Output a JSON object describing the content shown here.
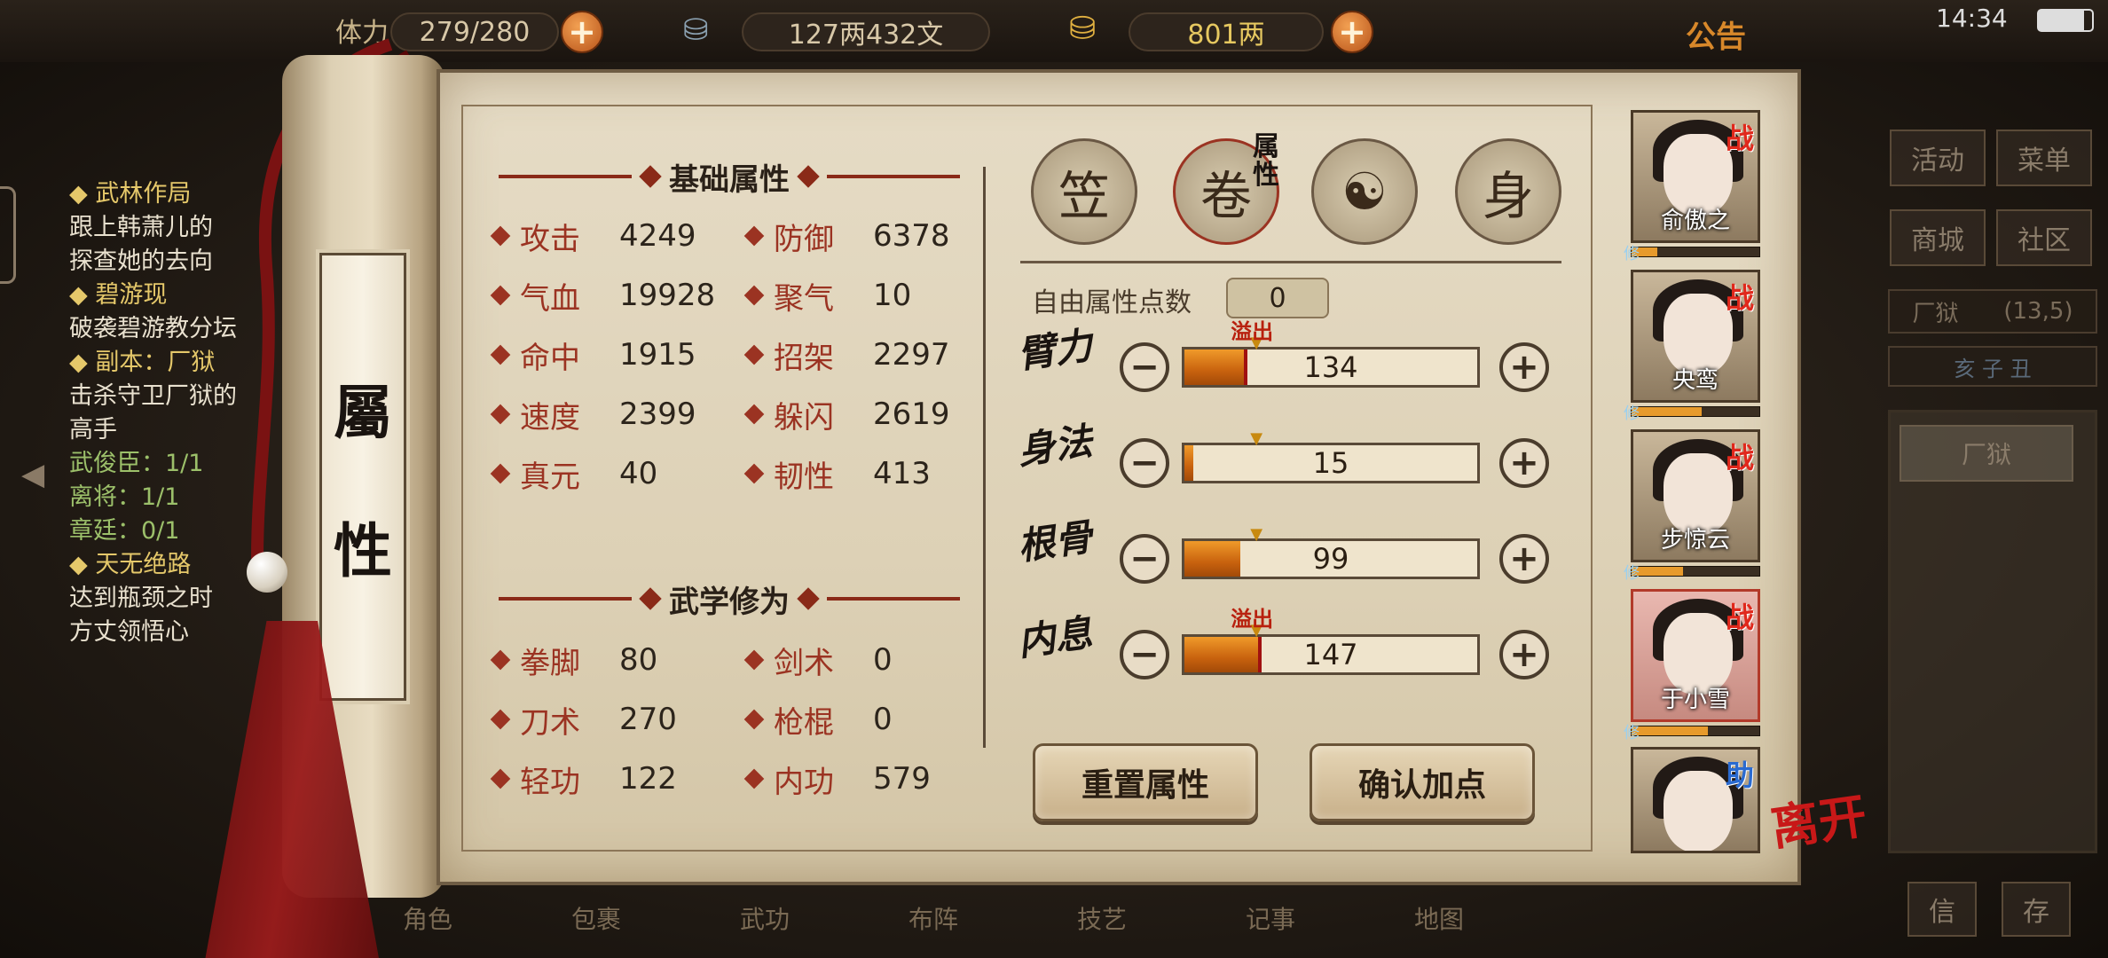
{
  "topbar": {
    "stamina_label": "体力",
    "stamina_value": "279/280",
    "silver": "127两432文",
    "gold": "801两",
    "announcement": "公告",
    "time": "14:34",
    "plus_glyph": "+"
  },
  "quest": {
    "lines": [
      {
        "text": "◆ 武林作局",
        "style": "h"
      },
      {
        "text": "跟上韩萧儿的",
        "style": "n"
      },
      {
        "text": "探查她的去向",
        "style": "n"
      },
      {
        "text": "◆ 碧游现",
        "style": "h"
      },
      {
        "text": "破袭碧游教分坛",
        "style": "n"
      },
      {
        "text": "◆ 副本：厂狱",
        "style": "h"
      },
      {
        "text": "击杀守卫厂狱的",
        "style": "n"
      },
      {
        "text": "高手",
        "style": "n"
      },
      {
        "text": "武俊臣：1/1",
        "style": "g"
      },
      {
        "text": "离将：1/1",
        "style": "g"
      },
      {
        "text": "章廷：0/1",
        "style": "g"
      },
      {
        "text": "◆ 天无绝路",
        "style": "h"
      },
      {
        "text": "达到瓶颈之时",
        "style": "n"
      },
      {
        "text": "方丈领悟心",
        "style": "n"
      }
    ]
  },
  "scroll": {
    "char1": "屬",
    "char2": "性"
  },
  "basic": {
    "title": "基础属性",
    "left": [
      {
        "name": "攻击",
        "value": "4249"
      },
      {
        "name": "气血",
        "value": "19928"
      },
      {
        "name": "命中",
        "value": "1915"
      },
      {
        "name": "速度",
        "value": "2399"
      },
      {
        "name": "真元",
        "value": "40"
      }
    ],
    "right": [
      {
        "name": "防御",
        "value": "6378"
      },
      {
        "name": "聚气",
        "value": "10"
      },
      {
        "name": "招架",
        "value": "2297"
      },
      {
        "name": "躲闪",
        "value": "2619"
      },
      {
        "name": "韧性",
        "value": "413"
      }
    ]
  },
  "martial": {
    "title": "武学修为",
    "left": [
      {
        "name": "拳脚",
        "value": "80"
      },
      {
        "name": "刀术",
        "value": "270"
      },
      {
        "name": "轻功",
        "value": "122"
      }
    ],
    "right": [
      {
        "name": "剑术",
        "value": "0"
      },
      {
        "name": "枪棍",
        "value": "0"
      },
      {
        "name": "内功",
        "value": "579"
      }
    ]
  },
  "tabs": {
    "icons": [
      "hat-icon",
      "attribute-scroll-icon",
      "bagua-icon",
      "meridian-body-icon"
    ],
    "glyphs": [
      "笠",
      "卷",
      "☯",
      "身"
    ],
    "attr_tab_label": "属性"
  },
  "allocation": {
    "free_points_label": "自由属性点数",
    "free_points": "0",
    "minus_glyph": "−",
    "plus_glyph": "+",
    "overflow_label": "溢出",
    "attrs": [
      {
        "name": "臂力",
        "value": "134",
        "fill": 0.21,
        "overflow": true,
        "marker": 0.2
      },
      {
        "name": "身法",
        "value": "15",
        "fill": 0.03,
        "overflow": false,
        "marker": 0.2
      },
      {
        "name": "根骨",
        "value": "99",
        "fill": 0.19,
        "overflow": false,
        "marker": 0.2
      },
      {
        "name": "内息",
        "value": "147",
        "fill": 0.26,
        "overflow": true,
        "marker": 0.2
      }
    ],
    "reset_label": "重置属性",
    "confirm_label": "确认加点"
  },
  "party": [
    {
      "name": "俞傲之",
      "tag": "战",
      "tag_type": "battle",
      "xp": 0.2,
      "selected": false
    },
    {
      "name": "央鸾",
      "tag": "战",
      "tag_type": "battle",
      "xp": 0.55,
      "selected": false
    },
    {
      "name": "步惊云",
      "tag": "战",
      "tag_type": "battle",
      "xp": 0.4,
      "selected": false
    },
    {
      "name": "于小雪",
      "tag": "战",
      "tag_type": "battle",
      "xp": 0.6,
      "selected": true
    },
    {
      "name": "",
      "tag": "助",
      "tag_type": "help",
      "xp": 0,
      "selected": false
    }
  ],
  "xp_badge": "修",
  "right_panel": {
    "buttons": [
      "活动",
      "菜单",
      "商城",
      "社区"
    ],
    "location": "厂狱",
    "coords": "(13,5)",
    "time_zodiac": "亥 子 丑",
    "map_label": "厂狱",
    "bottom": [
      "信",
      "存"
    ]
  },
  "leave_label": "离开",
  "bottom_bar": [
    "角色",
    "包裹",
    "武功",
    "布阵",
    "技艺",
    "记事",
    "地图"
  ],
  "colors": {
    "accent": "#9b3322",
    "bar_fill": "#e07a18",
    "battle_tag": "#e0281c"
  }
}
